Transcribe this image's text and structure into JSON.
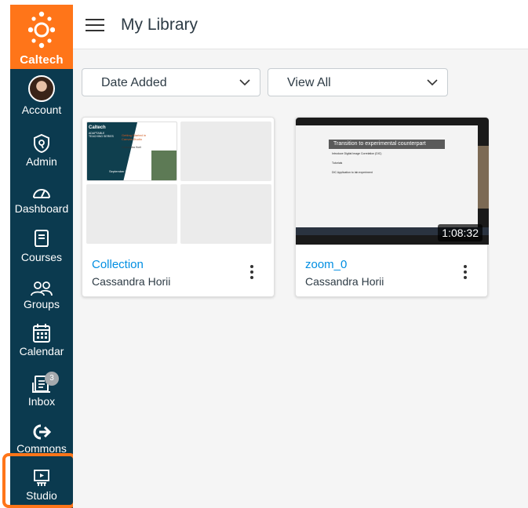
{
  "sidebar": {
    "brand": "Caltech",
    "items": [
      {
        "label": "Account"
      },
      {
        "label": "Admin"
      },
      {
        "label": "Dashboard"
      },
      {
        "label": "Courses"
      },
      {
        "label": "Groups"
      },
      {
        "label": "Calendar"
      },
      {
        "label": "Inbox",
        "badge": "3"
      },
      {
        "label": "Commons"
      },
      {
        "label": "Studio"
      }
    ],
    "highlight_color": "#ff7519"
  },
  "header": {
    "title": "My Library"
  },
  "filters": {
    "sort": {
      "value": "Date Added"
    },
    "view": {
      "value": "View All"
    }
  },
  "cards": [
    {
      "name": "Collection",
      "owner": "Cassandra Horii",
      "thumb": {
        "brand": "Caltech",
        "series": "ADAPTABLE TEACHING SERIES",
        "heading": "Getting Started in Canvas Studio",
        "presenter": "Cassandra Horii",
        "date": "September 1, 2020"
      }
    },
    {
      "name": "zoom_0",
      "owner": "Cassandra Horii",
      "duration": "1:08:32",
      "thumb": {
        "slide_title": "Transition to experimental counterpart",
        "line1": "Introduce Digital Image Correlation (DIC)",
        "line2": "Tutorials",
        "line3": "DIC Application to lab experiment"
      }
    }
  ],
  "colors": {
    "sidebar_bg": "#0b3a4f",
    "brand_orange": "#ff7519",
    "link": "#008ee2"
  }
}
